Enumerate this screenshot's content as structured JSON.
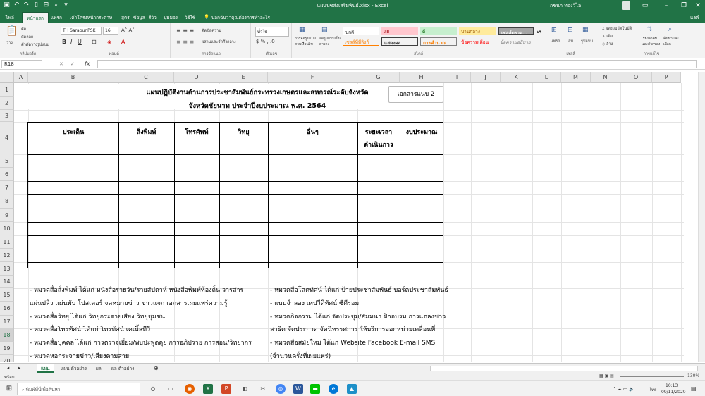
{
  "window": {
    "title": "แผนปชส่งเสริมพันธ์.xlsx - Excel",
    "user": "กชนก ทองวิไล",
    "share": "แชร์"
  },
  "tabs": [
    "ไฟล์",
    "หน้าแรก",
    "แทรก",
    "เค้าโครงหน้ากระดาษ",
    "สูตร",
    "ข้อมูล",
    "รีวิว",
    "มุมมอง",
    "วิธีใช้",
    "บอกฉันว่าคุณต้องการทำอะไร"
  ],
  "ribbon": {
    "clipboard_group": "คลิปบอร์ด",
    "cut": "ตัด",
    "copy": "คัดลอก",
    "format_painter": "ตัวคัดวางรูปแบบ",
    "paste": "วาง",
    "font_group": "ฟอนต์",
    "font_name": "TH SarabunPSK",
    "font_size": "16",
    "align_group": "การจัดแนว",
    "wrap_text": "ตัดข้อความ",
    "merge": "ผสานและจัดกึ่งกลาง",
    "number_group": "ตัวเลข",
    "number_format": "ทั่วไป",
    "styles_group": "สไตล์",
    "cond_format": "การจัดรูปแบบตามเงื่อนไข",
    "format_table": "จัดรูปแบบเป็นตาราง",
    "style_normal": "ปกติ",
    "style_bad": "แย่",
    "style_good": "ดี",
    "style_neutral": "ปานกลาง",
    "style_calc": "การคำนวณ",
    "style_check": "เซลล์ตรวจ...",
    "style_linked": "เซลล์ที่มีลิงก์",
    "style_output": "แสดงผล",
    "style_warning": "ข้อความเตือน",
    "style_explanatory": "ข้อความอธิบาย",
    "cells_group": "เซลล์",
    "insert": "แทรก",
    "delete": "ลบ",
    "format": "รูปแบบ",
    "editing_group": "การแก้ไข",
    "autosum": "ผลรวมอัตโนมัติ",
    "fill": "เติม",
    "clear": "ล้าง",
    "sort": "เรียงลำดับและตัวกรอง",
    "find": "ค้นหาและเลือก"
  },
  "formula": {
    "name_box": "R18",
    "fx": "fx",
    "content": ""
  },
  "columns": [
    "A",
    "B",
    "C",
    "D",
    "E",
    "F",
    "G",
    "H",
    "I",
    "J",
    "K",
    "L",
    "M",
    "N",
    "O",
    "P"
  ],
  "rows": [
    "1",
    "2",
    "3",
    "4",
    "5",
    "6",
    "7",
    "8",
    "9",
    "10",
    "11",
    "12",
    "13",
    "14",
    "15",
    "16",
    "17",
    "18",
    "19",
    "20"
  ],
  "sheet": {
    "title1": "แผนปฏิบัติงานด้านการประชาสัมพันธ์กระทรวงเกษตรและสหกรณ์ระดับจังหวัด",
    "title2": "จังหวัดชัยนาท  ประจำปีงบประมาณ พ.ศ. 2564",
    "attachment": "เอกสารแนบ 2",
    "headers": [
      "ประเด็น",
      "สิ่งพิมพ์",
      "โทรศัพท์",
      "วิทยุ",
      "อื่นๆ",
      "ระยะเวลา",
      "ดำเนินการ",
      "งบประมาณ"
    ],
    "notes_left": [
      "- หมวดสื่อสิ่งพิมพ์  ได้แก่  หนังสือรายวัน/รายสัปดาห์  หนังสือพิมพ์ท้องถิ่น  วารสาร",
      "   แผ่นปลิว  แผ่นพับ  โปสเตอร์  จดหมายข่าว  ข่าวแจก  เอกสารเผยแพร่ความรู้",
      "- หมวดสื่อวิทยุ  ได้แก่  วิทยุกระจายเสียง  วิทยุชุมชน",
      "- หมวดสื่อโทรทัศน์  ได้แก่  โทรทัศน์  เคเบิ้ลทีวี",
      "- หมวดสื่อบุคคล  ได้แก่  การตรวจเยี่ยม/พบปะพูดคุย  การอภิปราย  การสอน/วิทยากร",
      "- หมวดหอกระจายข่าว/เสียงตามสาย"
    ],
    "notes_right": [
      "- หมวดสื่อโสตทัศน์  ได้แก่  ป้ายประชาสัมพันธ์  บอร์ดประชาสัมพันธ์",
      "- แบบจำลอง  เทปวีดิทัศน์  ซีดีรอม",
      "- หมวดกิจกรรม  ได้แก่  จัดประชุม/สัมมนา  ฝึกอบรม  การแถลงข่าว",
      "   สาธิต  จัดประกวด  จัดนิทรรศการ  ให้บริการออกหน่วยเคลื่อนที่",
      "- หมวดสื่อสมัยใหม่  ได้แก่  Website  Facebook  E-mail  SMS",
      "   (จำนวนครั้งที่เผยแพร่)"
    ]
  },
  "sheet_tabs": [
    "แผน",
    "แผน ตัวอย่าง",
    "ผล",
    "ผล ตัวอย่าง"
  ],
  "status": {
    "ready": "พร้อม",
    "zoom": "130%"
  },
  "taskbar": {
    "search": "พิมพ์ที่นี่เพื่อค้นหา",
    "time": "10:13",
    "date": "09/11/2020",
    "lang": "ไทย"
  },
  "colors": {
    "excel_green": "#217346"
  }
}
